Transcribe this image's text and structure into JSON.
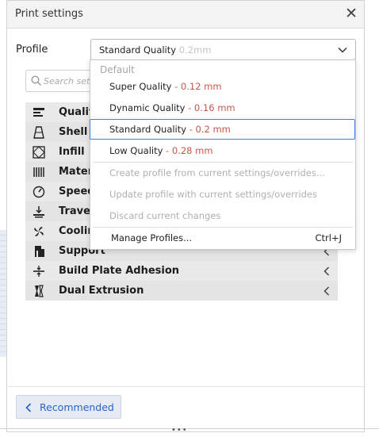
{
  "panel": {
    "title": "Print settings",
    "close_glyph": "✕"
  },
  "profile": {
    "label": "Profile",
    "selected_name": "Standard Quality",
    "selected_suffix": "0.2mm"
  },
  "search": {
    "placeholder": "Search setti"
  },
  "categories": [
    {
      "label": "Qualit",
      "icon": "quality-icon"
    },
    {
      "label": "Shell",
      "icon": "shell-icon"
    },
    {
      "label": "Infill",
      "icon": "infill-icon"
    },
    {
      "label": "Mater",
      "icon": "material-icon"
    },
    {
      "label": "Speed",
      "icon": "speed-icon"
    },
    {
      "label": "Travel",
      "icon": "travel-icon"
    },
    {
      "label": "Coolin",
      "icon": "cooling-icon"
    },
    {
      "label": "Support",
      "icon": "support-icon"
    },
    {
      "label": "Build Plate Adhesion",
      "icon": "build-plate-icon"
    },
    {
      "label": "Dual Extrusion",
      "icon": "dual-extrusion-icon"
    }
  ],
  "dropdown": {
    "section_label": "Default",
    "profiles": [
      {
        "name": "Super Quality",
        "suffix": " - 0.12 mm"
      },
      {
        "name": "Dynamic Quality",
        "suffix": " - 0.16 mm"
      },
      {
        "name": "Standard Quality",
        "suffix": " - 0.2 mm"
      },
      {
        "name": "Low Quality",
        "suffix": " - 0.28 mm"
      }
    ],
    "actions": [
      {
        "label": "Create profile from current settings/overrides..."
      },
      {
        "label": "Update profile with current settings/overrides"
      },
      {
        "label": "Discard current changes"
      }
    ],
    "manage": {
      "label": "Manage Profiles...",
      "shortcut": "Ctrl+J"
    }
  },
  "footer": {
    "recommended_label": "Recommended",
    "grip": "•••"
  },
  "colors": {
    "accent": "#3f7be0",
    "link": "#2864c7",
    "category_bg": "#e4e4e4"
  }
}
